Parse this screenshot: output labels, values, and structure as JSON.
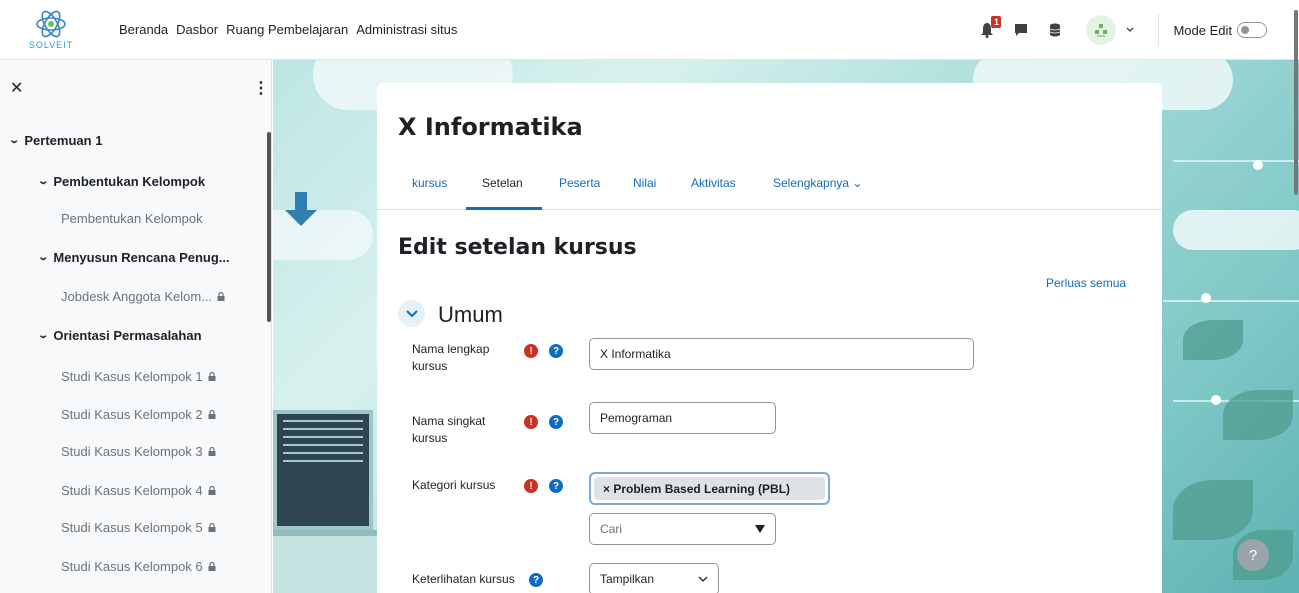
{
  "brand": {
    "logo_text": "SOLVEIT"
  },
  "nav": {
    "links": [
      "Beranda",
      "Dasbor",
      "Ruang Pembelajaran",
      "Administrasi situs"
    ],
    "notification_count": "1",
    "mode_edit_label": "Mode Edit"
  },
  "drawer": {
    "items": [
      {
        "label": "Pertemuan 1",
        "level": 0,
        "expanded": true
      },
      {
        "label": "Pembentukan Kelompok",
        "level": 1,
        "expanded": true
      },
      {
        "label": "Pembentukan Kelompok",
        "level": 2
      },
      {
        "label": "Menyusun Rencana Penug...",
        "level": 1,
        "expanded": true
      },
      {
        "label": "Jobdesk Anggota Kelom...",
        "level": 2,
        "locked": true
      },
      {
        "label": "Orientasi Permasalahan",
        "level": 1,
        "expanded": true
      },
      {
        "label": "Studi Kasus Kelompok 1",
        "level": 2,
        "locked": true
      },
      {
        "label": "Studi Kasus Kelompok 2",
        "level": 2,
        "locked": true
      },
      {
        "label": "Studi Kasus Kelompok 3",
        "level": 2,
        "locked": true
      },
      {
        "label": "Studi Kasus Kelompok 4",
        "level": 2,
        "locked": true
      },
      {
        "label": "Studi Kasus Kelompok 5",
        "level": 2,
        "locked": true
      },
      {
        "label": "Studi Kasus Kelompok 6",
        "level": 2,
        "locked": true
      }
    ]
  },
  "course": {
    "title": "X Informatika",
    "tabs": [
      {
        "label": "kursus",
        "active": false
      },
      {
        "label": "Setelan",
        "active": true
      },
      {
        "label": "Peserta",
        "active": false
      },
      {
        "label": "Nilai",
        "active": false
      },
      {
        "label": "Aktivitas",
        "active": false
      },
      {
        "label": "Selengkapnya ⌄",
        "active": false
      }
    ]
  },
  "form": {
    "page_title": "Edit setelan kursus",
    "expand_all": "Perluas semua",
    "section_title": "Umum",
    "fullname": {
      "label": "Nama lengkap kursus",
      "value": "X Informatika"
    },
    "shortname": {
      "label": "Nama singkat kursus",
      "value": "Pemograman"
    },
    "category": {
      "label": "Kategori kursus",
      "selected": "× Problem Based Learning (PBL)",
      "search_placeholder": "Cari"
    },
    "visibility": {
      "label": "Keterlihatan kursus",
      "value": "Tampilkan"
    }
  },
  "help_button": "?",
  "colors": {
    "primary": "#0f6cbf",
    "required": "#ca3120",
    "badge": "#ca3120"
  }
}
